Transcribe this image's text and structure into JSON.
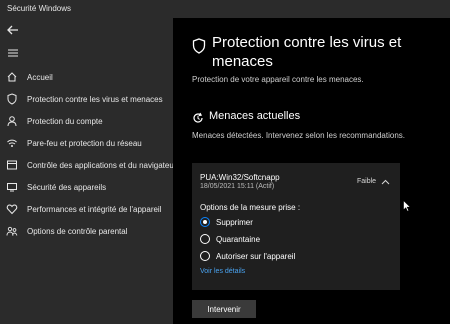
{
  "window": {
    "title": "Sécurité Windows"
  },
  "sidebar": {
    "back_icon": "back-arrow-icon",
    "menu_icon": "hamburger-menu-icon",
    "items": [
      {
        "label": "Accueil",
        "icon": "home-icon"
      },
      {
        "label": "Protection contre les virus et menaces",
        "icon": "shield-icon"
      },
      {
        "label": "Protection du compte",
        "icon": "person-icon"
      },
      {
        "label": "Pare-feu et protection du réseau",
        "icon": "wifi-icon"
      },
      {
        "label": "Contrôle des applications et du navigateur",
        "icon": "app-window-icon"
      },
      {
        "label": "Sécurité des appareils",
        "icon": "device-icon"
      },
      {
        "label": "Performances et intégrité de l'appareil",
        "icon": "heart-icon"
      },
      {
        "label": "Options de contrôle parental",
        "icon": "family-icon"
      }
    ]
  },
  "main": {
    "title": "Protection contre les virus et menaces",
    "subtitle": "Protection de votre appareil contre les menaces.",
    "section": {
      "icon": "refresh-icon",
      "title": "Menaces actuelles",
      "subtitle": "Menaces détectées. Intervenez selon les recommandations."
    },
    "threat": {
      "name": "PUA:Win32/Softcnapp",
      "date": "18/05/2021 15:11 (Actif)",
      "severity": "Faible",
      "options_label": "Options de la mesure prise :",
      "options": [
        {
          "label": "Supprimer",
          "selected": true
        },
        {
          "label": "Quarantaine",
          "selected": false
        },
        {
          "label": "Autoriser sur l'appareil",
          "selected": false
        }
      ],
      "details_link": "Voir les détails"
    },
    "action_button": "Intervenir"
  },
  "colors": {
    "background": "#000000",
    "sidebar": "#2b2b2b",
    "card": "#1f1f1f",
    "accent": "#0a84ff",
    "link": "#4aa3f0",
    "button": "#3a3a3a"
  }
}
